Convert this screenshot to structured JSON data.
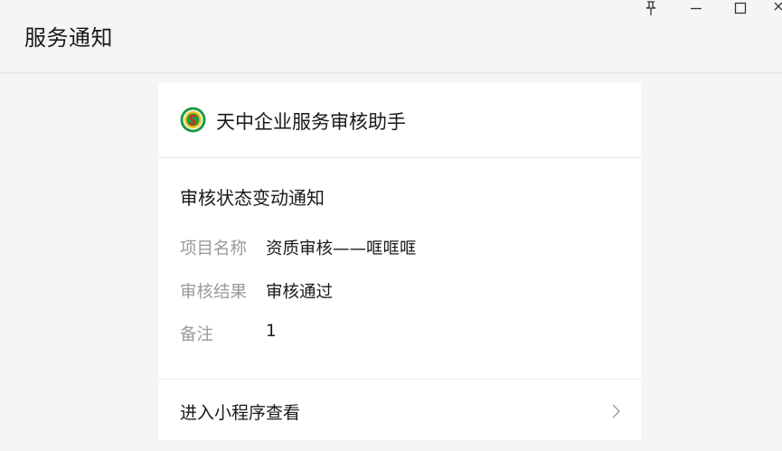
{
  "window": {
    "title": "服务通知",
    "controls": [
      "pin-icon",
      "minimize-icon",
      "maximize-icon",
      "close-icon"
    ]
  },
  "card": {
    "service_name": "天中企业服务审核助手",
    "message_title": "审核状态变动通知",
    "fields": [
      {
        "label": "项目名称",
        "value": "资质审核——哐哐哐"
      },
      {
        "label": "审核结果",
        "value": "审核通过"
      },
      {
        "label": "备注",
        "value": "1"
      }
    ],
    "footer_action": "进入小程序查看"
  },
  "colors": {
    "background": "#f5f5f5",
    "card": "#ffffff",
    "label_gray": "#9a9a9a",
    "text": "#191919",
    "logo_green": "#1f9a43",
    "logo_yellow": "#f2c21a",
    "logo_red": "#d8291c"
  }
}
